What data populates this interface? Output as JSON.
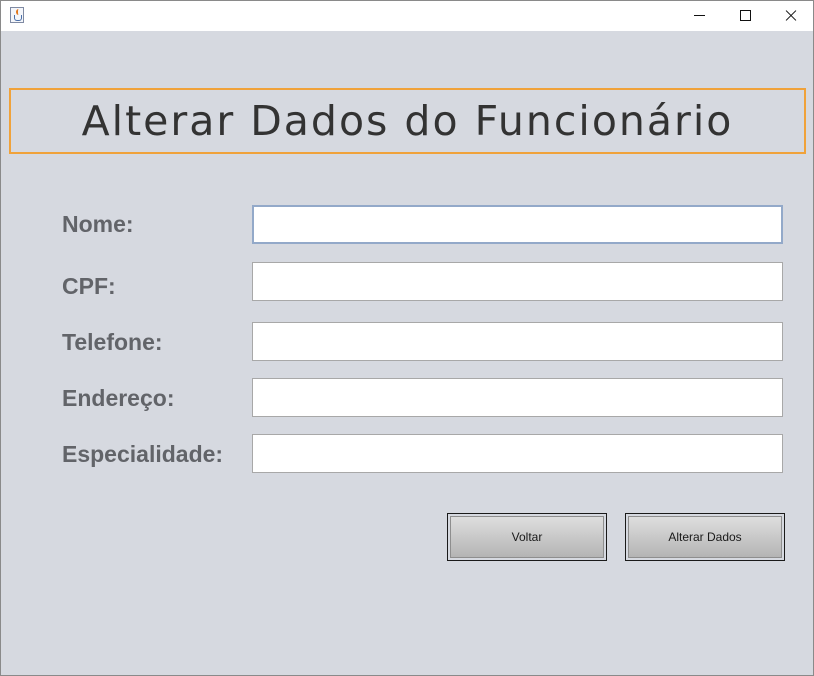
{
  "window": {
    "title": "",
    "app_icon": "java-cup-icon",
    "controls": [
      "minimize-icon",
      "maximize-icon",
      "close-icon"
    ]
  },
  "header": {
    "title": "Alterar Dados do Funcionário",
    "border_color": "#f0a23a"
  },
  "form": {
    "fields": [
      {
        "label": "Nome:",
        "value": ""
      },
      {
        "label": "CPF:",
        "value": ""
      },
      {
        "label": "Telefone:",
        "value": ""
      },
      {
        "label": "Endereço:",
        "value": ""
      },
      {
        "label": "Especialidade:",
        "value": ""
      }
    ]
  },
  "buttons": {
    "back_label": "Voltar",
    "submit_label": "Alterar Dados"
  },
  "colors": {
    "background": "#d6d9e0",
    "label_text": "#626469",
    "focus_border": "#93a9c9"
  }
}
